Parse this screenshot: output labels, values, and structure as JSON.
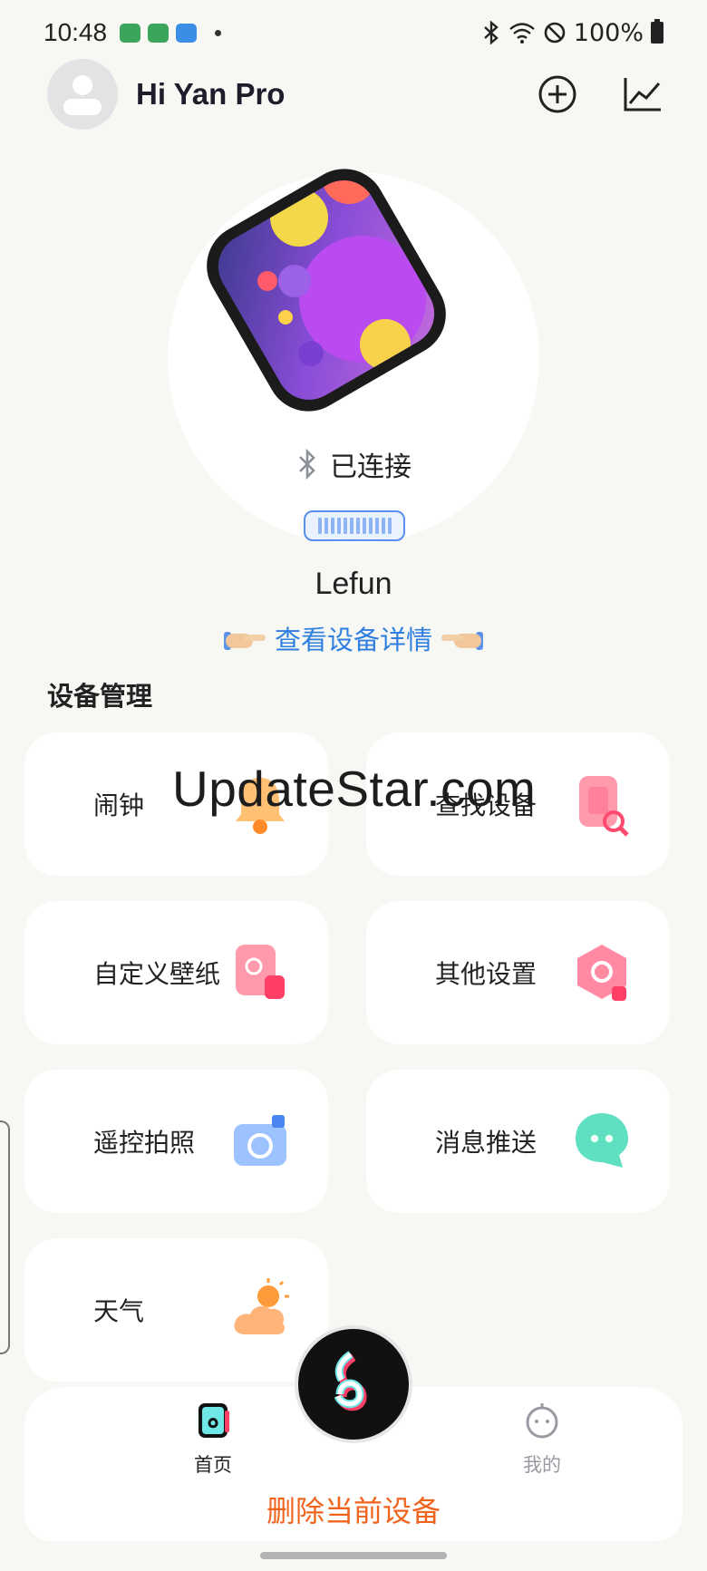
{
  "status_bar": {
    "time": "10:48",
    "battery_percent": "100%"
  },
  "header": {
    "app_title": "Hi Yan Pro"
  },
  "device": {
    "connection_status": "已连接",
    "battery_level": 1.0,
    "name": "Lefun",
    "detail_link_label": "查看设备详情"
  },
  "management": {
    "title": "设备管理",
    "items": [
      {
        "label": "闹钟",
        "icon": "alarm-bell-icon"
      },
      {
        "label": "查找设备",
        "icon": "find-device-icon"
      },
      {
        "label": "自定义壁纸",
        "icon": "wallpaper-icon"
      },
      {
        "label": "其他设置",
        "icon": "settings-hexagon-icon"
      },
      {
        "label": "遥控拍照",
        "icon": "camera-icon"
      },
      {
        "label": "消息推送",
        "icon": "message-bubble-icon"
      },
      {
        "label": "天气",
        "icon": "weather-cloud-sun-icon"
      }
    ]
  },
  "watermark": "UpdateStar.com",
  "tabbar": {
    "home_label": "首页",
    "mine_label": "我的"
  },
  "delete_button_label": "删除当前设备",
  "colors": {
    "background": "#f7f7f4",
    "link_blue": "#2f7fe0",
    "delete_orange": "#f0641e",
    "battery_blue": "#5a8ff0"
  }
}
